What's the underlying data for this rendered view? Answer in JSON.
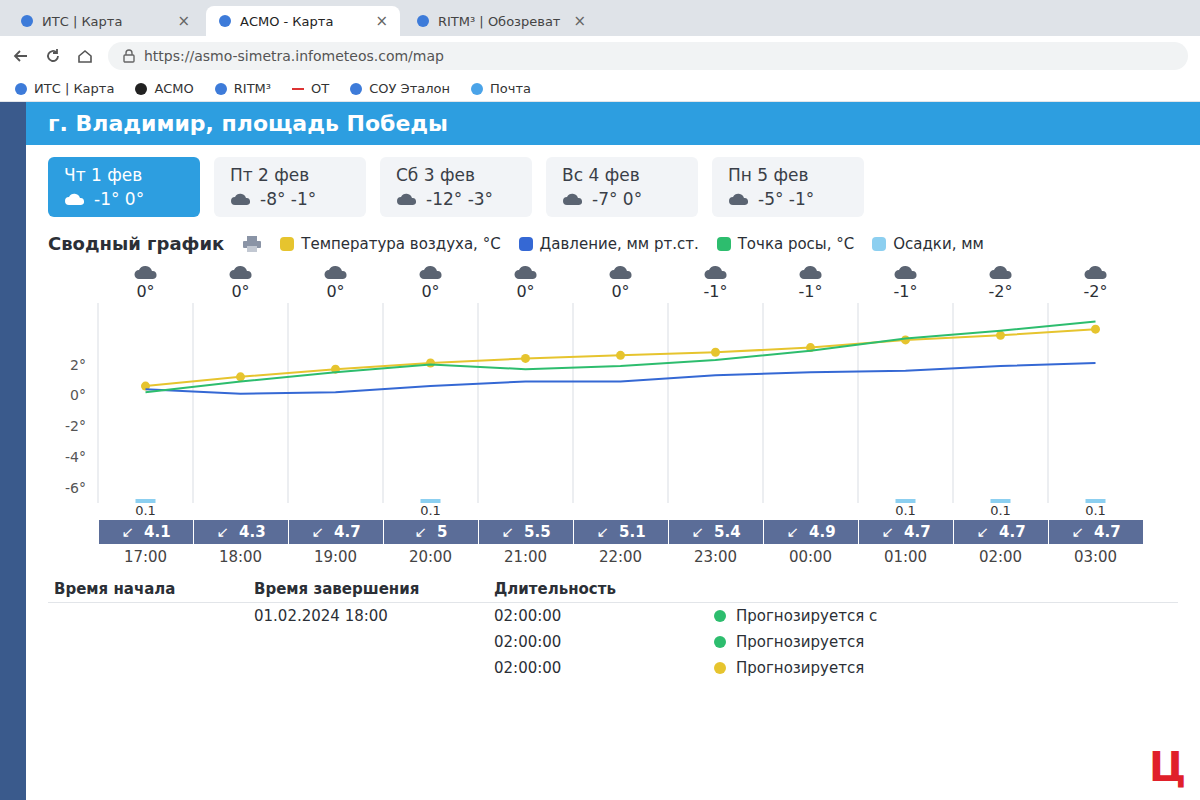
{
  "browser": {
    "tabs": [
      {
        "label": "ИТС | Карта",
        "selected": false
      },
      {
        "label": "АСМО - Карта",
        "selected": true
      },
      {
        "label": "RITM³ | Обозреват",
        "selected": false
      }
    ],
    "close_icon": "×",
    "url": "https://asmo-simetra.infometeos.com/map",
    "bookmarks": [
      "ИТС | Карта",
      "АСМО",
      "RITM³",
      "ОТ",
      "СОУ Эталон",
      "Почта"
    ]
  },
  "location": "г. Владимир, площадь Победы",
  "days": [
    {
      "label": "Чт 1 фев",
      "temps": "-1° 0°",
      "selected": true
    },
    {
      "label": "Пт 2 фев",
      "temps": "-8° -1°",
      "selected": false
    },
    {
      "label": "Сб 3 фев",
      "temps": "-12° -3°",
      "selected": false
    },
    {
      "label": "Вс 4 фев",
      "temps": "-7° 0°",
      "selected": false
    },
    {
      "label": "Пн 5 фев",
      "temps": "-5° -1°",
      "selected": false
    }
  ],
  "chart": {
    "title": "Сводный график",
    "legend": [
      {
        "label": "Температура воздуха, °C",
        "color": "#e6c42e"
      },
      {
        "label": "Давление, мм рт.ст.",
        "color": "#3568d4"
      },
      {
        "label": "Точка росы, °C",
        "color": "#2dbd6e"
      },
      {
        "label": "Осадки, мм",
        "color": "#8ccff0"
      }
    ],
    "y_ticks": [
      {
        "label": "2°",
        "value": 2
      },
      {
        "label": "0°",
        "value": 0
      },
      {
        "label": "-2°",
        "value": -2
      },
      {
        "label": "-4°",
        "value": -4
      },
      {
        "label": "-6°",
        "value": -6
      }
    ],
    "times": [
      "17:00",
      "18:00",
      "19:00",
      "20:00",
      "21:00",
      "22:00",
      "23:00",
      "00:00",
      "01:00",
      "02:00",
      "03:00"
    ],
    "temp_labels": [
      "0°",
      "0°",
      "0°",
      "0°",
      "0°",
      "0°",
      "-1°",
      "-1°",
      "-1°",
      "-2°",
      "-2°"
    ],
    "wind_arrow": "↙",
    "wind": [
      "4.1",
      "4.3",
      "4.7",
      "5",
      "5.5",
      "5.1",
      "5.4",
      "4.9",
      "4.7",
      "4.7",
      "4.7"
    ],
    "precip_labels": [
      "0.1",
      null,
      null,
      "0.1",
      null,
      null,
      null,
      null,
      "0.1",
      "0.1",
      "0.1"
    ],
    "series": {
      "temperature": [
        0.6,
        1.2,
        1.7,
        2.1,
        2.4,
        2.6,
        2.8,
        3.1,
        3.6,
        3.9,
        4.3
      ],
      "pressure": [
        0.4,
        0.1,
        0.2,
        0.6,
        0.9,
        0.9,
        1.3,
        1.5,
        1.6,
        1.9,
        2.1
      ],
      "dew_point": [
        0.2,
        0.9,
        1.5,
        2.0,
        1.7,
        1.9,
        2.3,
        2.9,
        3.7,
        4.2,
        4.8
      ],
      "precipitation": [
        0.1,
        0,
        0,
        0.1,
        0,
        0,
        0,
        0,
        0.1,
        0.1,
        0.1
      ]
    }
  },
  "table": {
    "columns": [
      "Время начала",
      "Время завершения",
      "Длительность"
    ],
    "rows": [
      {
        "end": "01.02.2024 18:00",
        "duration": "02:00:00",
        "status": "Прогнозируется с",
        "color": "#2dbd6e"
      },
      {
        "duration": "02:00:00",
        "status": "Прогнозируется",
        "color": "#2dbd6e"
      },
      {
        "duration": "02:00:00",
        "status": "Прогнозируется",
        "color": "#e6c42e"
      }
    ]
  },
  "watermark": "Ц"
}
